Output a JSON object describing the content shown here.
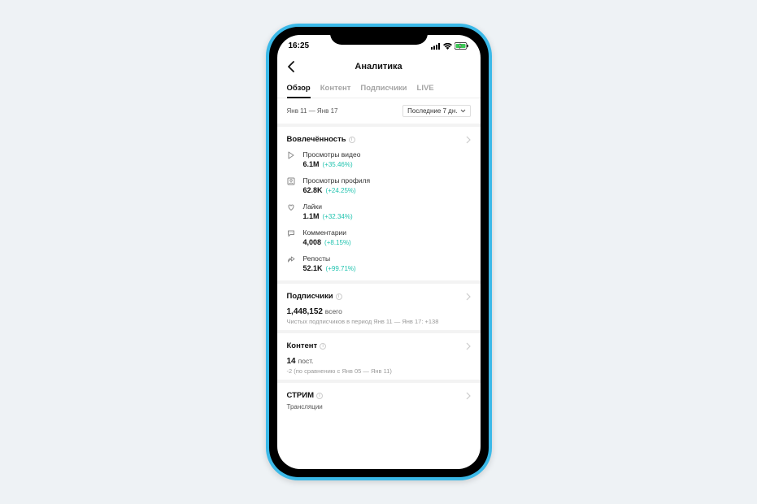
{
  "status": {
    "time": "16:25"
  },
  "nav": {
    "title": "Аналитика"
  },
  "tabs": {
    "overview": "Обзор",
    "content": "Контент",
    "followers": "Подписчики",
    "live": "LIVE"
  },
  "dateRow": {
    "range": "Янв 11 — Янв 17",
    "picker": "Последние 7 дн."
  },
  "engagement": {
    "title": "Вовлечённость",
    "metrics": {
      "videoViews": {
        "label": "Просмотры видео",
        "value": "6.1M",
        "change": "(+35.46%)"
      },
      "profileViews": {
        "label": "Просмотры профиля",
        "value": "62.8K",
        "change": "(+24.25%)"
      },
      "likes": {
        "label": "Лайки",
        "value": "1.1M",
        "change": "(+32.34%)"
      },
      "comments": {
        "label": "Комментарии",
        "value": "4,008",
        "change": "(+8.15%)"
      },
      "shares": {
        "label": "Репосты",
        "value": "52.1K",
        "change": "(+99.71%)"
      }
    }
  },
  "followers": {
    "title": "Подписчики",
    "total": "1,448,152",
    "totalLabel": "всего",
    "note": "Чистых подписчиков в период Янв 11 — Янв 17: +138"
  },
  "contentSec": {
    "title": "Контент",
    "count": "14",
    "countLabel": "пост.",
    "note": "-2 (по сравнению с Янв 05 — Янв 11)"
  },
  "stream": {
    "title": "СТРИМ",
    "sub": "Трансляции"
  }
}
